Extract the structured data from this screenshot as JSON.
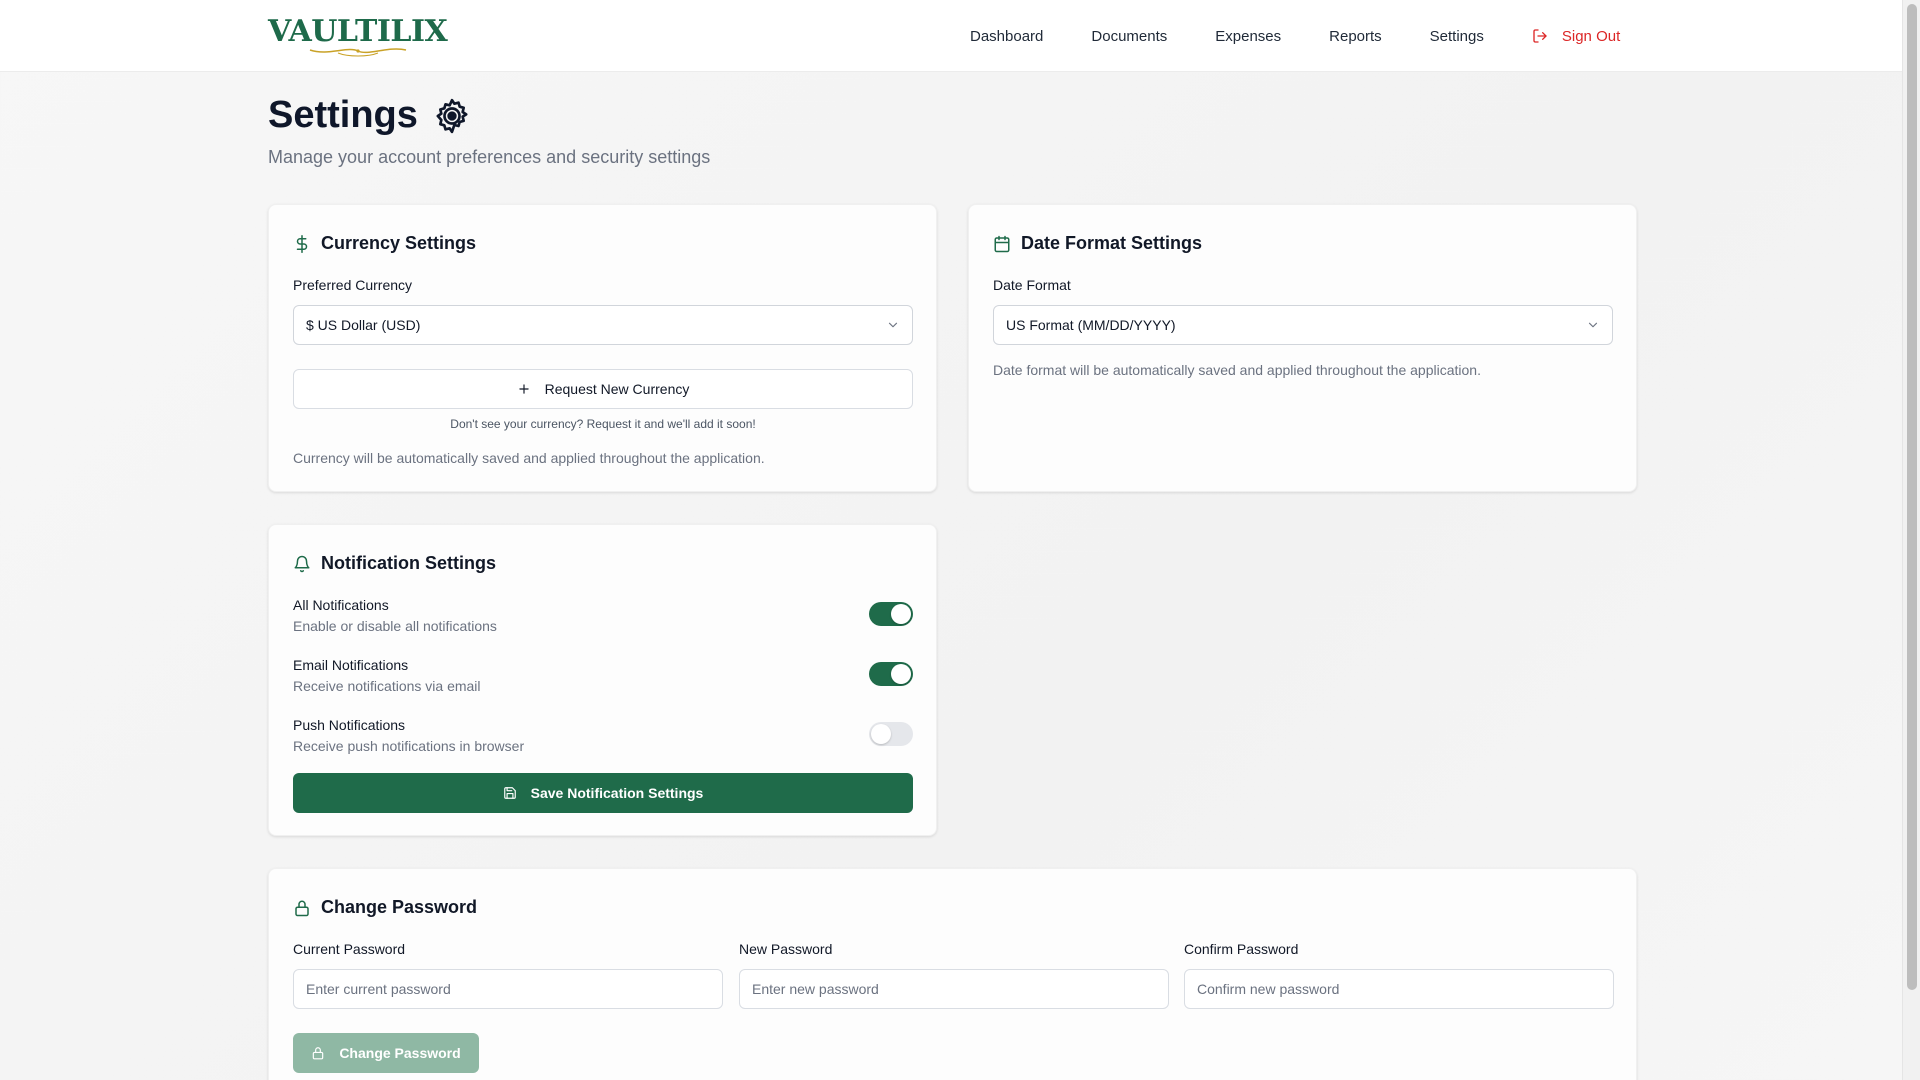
{
  "header": {
    "logo_text": "VAULTILIX",
    "nav": [
      {
        "label": "Dashboard"
      },
      {
        "label": "Documents"
      },
      {
        "label": "Expenses"
      },
      {
        "label": "Reports"
      },
      {
        "label": "Settings"
      }
    ],
    "sign_out_label": "Sign Out",
    "colors": {
      "brand": "#1e6a4a",
      "sign_out": "#dc2626",
      "logo_swash": "#c9a227"
    }
  },
  "page": {
    "title": "Settings",
    "title_icon": "gear-icon",
    "subtitle": "Manage your account preferences and security settings"
  },
  "currency": {
    "title": "Currency Settings",
    "icon": "dollar-icon",
    "label": "Preferred Currency",
    "selected": "$ US Dollar (USD)",
    "request_button": "Request New Currency",
    "hint": "Don't see your currency? Request it and we'll add it soon!",
    "note": "Currency will be automatically saved and applied throughout the application."
  },
  "date_format": {
    "title": "Date Format Settings",
    "icon": "calendar-icon",
    "label": "Date Format",
    "selected": "US Format (MM/DD/YYYY)",
    "note": "Date format will be automatically saved and applied throughout the application."
  },
  "notifications": {
    "title": "Notification Settings",
    "icon": "bell-icon",
    "items": [
      {
        "title": "All Notifications",
        "desc": "Enable or disable all notifications",
        "enabled": true
      },
      {
        "title": "Email Notifications",
        "desc": "Receive notifications via email",
        "enabled": true
      },
      {
        "title": "Push Notifications",
        "desc": "Receive push notifications in browser",
        "enabled": false
      }
    ],
    "save_button": "Save Notification Settings",
    "colors": {
      "toggle_on": "#1f6b4a",
      "toggle_off": "#e5e7eb",
      "primary": "#1f6b4a"
    }
  },
  "password": {
    "title": "Change Password",
    "icon": "lock-icon",
    "current_label": "Current Password",
    "current_placeholder": "Enter current password",
    "new_label": "New Password",
    "new_placeholder": "Enter new password",
    "confirm_label": "Confirm Password",
    "confirm_placeholder": "Confirm new password",
    "button": "Change Password",
    "colors": {
      "button_disabled": "#8fb8a4"
    }
  }
}
